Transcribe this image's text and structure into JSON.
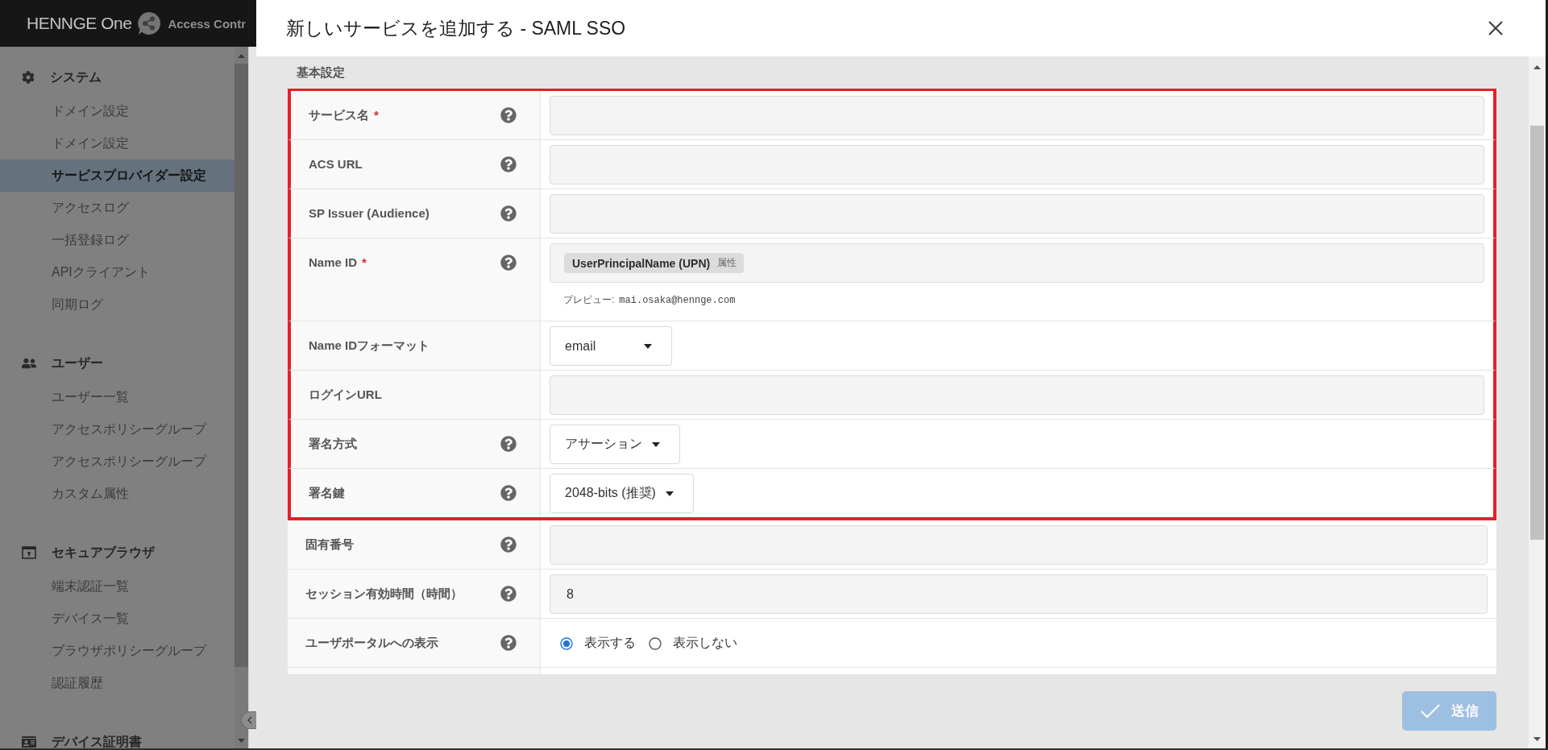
{
  "app": {
    "logo": "HENNGE One",
    "product": "Access Contr"
  },
  "sidebar": {
    "groups": [
      {
        "title": "システム",
        "items": [
          {
            "label": "ドメイン設定",
            "selected": false
          },
          {
            "label": "ドメイン設定",
            "selected": false
          },
          {
            "label": "サービスプロバイダー設定",
            "selected": true
          },
          {
            "label": "アクセスログ",
            "selected": false
          },
          {
            "label": "一括登録ログ",
            "selected": false
          },
          {
            "label": "APIクライアント",
            "selected": false
          },
          {
            "label": "同期ログ",
            "selected": false
          }
        ]
      },
      {
        "title": "ユーザー",
        "items": [
          {
            "label": "ユーザー一覧",
            "selected": false
          },
          {
            "label": "アクセスポリシーグループ",
            "selected": false
          },
          {
            "label": "アクセスポリシーグループ",
            "selected": false
          },
          {
            "label": "カスタム属性",
            "selected": false
          }
        ]
      },
      {
        "title": "セキュアブラウザ",
        "items": [
          {
            "label": "端末認証一覧",
            "selected": false
          },
          {
            "label": "デバイス一覧",
            "selected": false
          },
          {
            "label": "ブラウザポリシーグループ",
            "selected": false
          },
          {
            "label": "認証履歴",
            "selected": false
          }
        ]
      },
      {
        "title": "デバイス証明書"
      }
    ]
  },
  "modal": {
    "title": "新しいサービスを追加する - SAML SSO",
    "section": "基本設定",
    "rows": [
      {
        "label": "サービス名",
        "required_mark": "*",
        "help": true,
        "highlighted": true,
        "field": {
          "kind": "input"
        }
      },
      {
        "label": "ACS URL",
        "help": true,
        "highlighted": true,
        "field": {
          "kind": "input"
        }
      },
      {
        "label": "SP Issuer (Audience)",
        "help": true,
        "highlighted": true,
        "field": {
          "kind": "input"
        }
      },
      {
        "label": "Name ID",
        "required_mark": "*",
        "help": true,
        "highlighted": true,
        "field": {
          "kind": "tag-input",
          "tag": "UserPrincipalName (UPN)",
          "tag_note": "属性",
          "preview_label": "プレビュー:",
          "preview_value": "mai.osaka@hennge.com"
        }
      },
      {
        "label": "Name IDフォーマット",
        "help": false,
        "highlighted": true,
        "field": {
          "kind": "select",
          "value": "email"
        }
      },
      {
        "label": "ログインURL",
        "help": false,
        "highlighted": true,
        "field": {
          "kind": "input"
        }
      },
      {
        "label": "署名方式",
        "help": true,
        "highlighted": true,
        "field": {
          "kind": "select",
          "value": "アサーション"
        }
      },
      {
        "label": "署名鍵",
        "help": true,
        "highlighted": true,
        "field": {
          "kind": "select",
          "value": "2048-bits (推奨)"
        }
      },
      {
        "label": "固有番号",
        "help": true,
        "highlighted": false,
        "field": {
          "kind": "input"
        }
      },
      {
        "label": "セッション有効時間（時間）",
        "help": true,
        "highlighted": false,
        "field": {
          "kind": "input",
          "value": "8"
        }
      },
      {
        "label": "ユーザポータルへの表示",
        "help": true,
        "highlighted": false,
        "field": {
          "kind": "radio",
          "options": [
            {
              "label": "表示する",
              "selected": true
            },
            {
              "label": "表示しない",
              "selected": false
            }
          ]
        }
      }
    ],
    "submit": {
      "label": "送信",
      "disabled": true
    }
  }
}
